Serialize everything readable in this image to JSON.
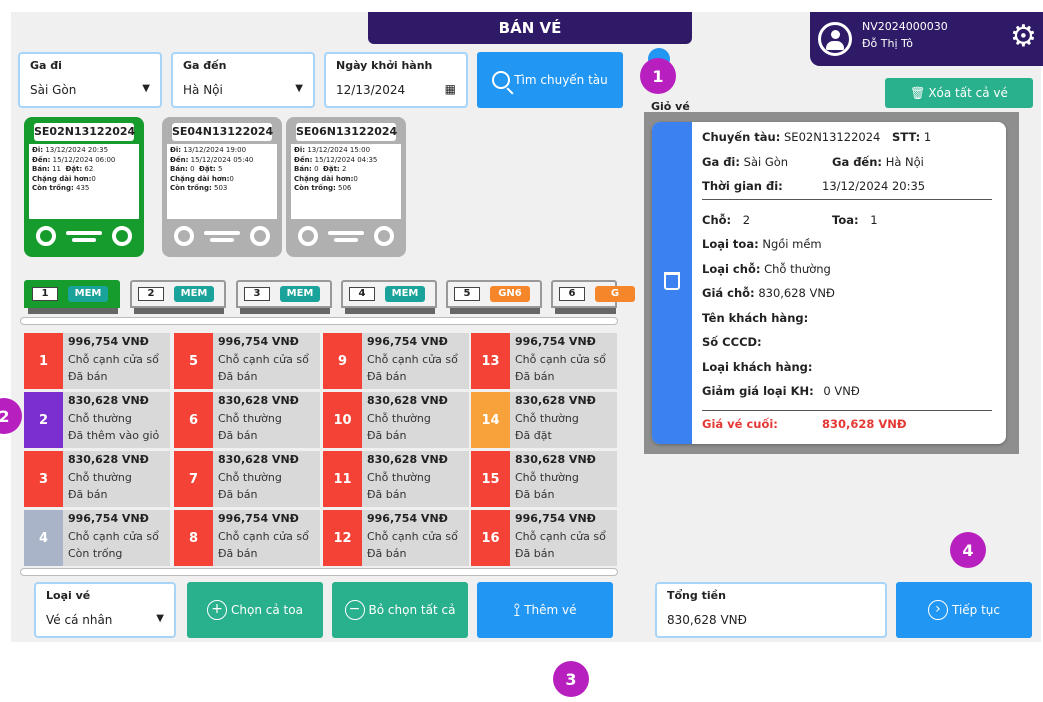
{
  "header": {
    "title": "BÁN VÉ",
    "user_id": "NV2024000030",
    "user_name": "Đỗ Thị Tô"
  },
  "search": {
    "from_label": "Ga đi",
    "from_value": "Sài Gòn",
    "to_label": "Ga đến",
    "to_value": "Hà Nội",
    "date_label": "Ngày khởi hành",
    "date_value": "12/13/2024",
    "search_button": "Tìm chuyến tàu"
  },
  "trains": [
    {
      "code": "SE02N13122024",
      "di": "13/12/2024 20:35",
      "den": "15/12/2024 06:00",
      "ban": "11",
      "dat": "62",
      "chang": "0",
      "trong": "435"
    },
    {
      "code": "SE04N13122024",
      "di": "13/12/2024 19:00",
      "den": "15/12/2024 05:40",
      "ban": "0",
      "dat": "5",
      "chang": "0",
      "trong": "503"
    },
    {
      "code": "SE06N13122024",
      "di": "13/12/2024 15:00",
      "den": "15/12/2024 04:35",
      "ban": "0",
      "dat": "2",
      "chang": "0",
      "trong": "506"
    }
  ],
  "train_labels": {
    "di": "Đi:",
    "den": "Đến:",
    "ban": "Bán:",
    "dat": "Đặt:",
    "chang": "Chặng dài hơn:",
    "trong": "Còn trống:"
  },
  "cars": [
    {
      "num": "1",
      "type": "MEM"
    },
    {
      "num": "2",
      "type": "MEM"
    },
    {
      "num": "3",
      "type": "MEM"
    },
    {
      "num": "4",
      "type": "MEM"
    },
    {
      "num": "5",
      "type": "GN6"
    },
    {
      "num": "6",
      "type": "G"
    }
  ],
  "seats": [
    {
      "num": "1",
      "price": "996,754 VNĐ",
      "kind": "Chỗ cạnh cửa sổ",
      "status": "Đã bán"
    },
    {
      "num": "2",
      "price": "830,628 VNĐ",
      "kind": "Chỗ thường",
      "status": "Đã thêm vào giỏ"
    },
    {
      "num": "3",
      "price": "830,628 VNĐ",
      "kind": "Chỗ thường",
      "status": "Đã bán"
    },
    {
      "num": "4",
      "price": "996,754 VNĐ",
      "kind": "Chỗ cạnh cửa sổ",
      "status": "Còn trống"
    },
    {
      "num": "5",
      "price": "996,754 VNĐ",
      "kind": "Chỗ cạnh cửa sổ",
      "status": "Đã bán"
    },
    {
      "num": "6",
      "price": "830,628 VNĐ",
      "kind": "Chỗ thường",
      "status": "Đã bán"
    },
    {
      "num": "7",
      "price": "830,628 VNĐ",
      "kind": "Chỗ thường",
      "status": "Đã bán"
    },
    {
      "num": "8",
      "price": "996,754 VNĐ",
      "kind": "Chỗ cạnh cửa sổ",
      "status": "Đã bán"
    },
    {
      "num": "9",
      "price": "996,754 VNĐ",
      "kind": "Chỗ cạnh cửa sổ",
      "status": "Đã bán"
    },
    {
      "num": "10",
      "price": "830,628 VNĐ",
      "kind": "Chỗ thường",
      "status": "Đã bán"
    },
    {
      "num": "11",
      "price": "830,628 VNĐ",
      "kind": "Chỗ thường",
      "status": "Đã bán"
    },
    {
      "num": "12",
      "price": "996,754 VNĐ",
      "kind": "Chỗ cạnh cửa sổ",
      "status": "Đã bán"
    },
    {
      "num": "13",
      "price": "996,754 VNĐ",
      "kind": "Chỗ cạnh cửa sổ",
      "status": "Đã bán"
    },
    {
      "num": "14",
      "price": "830,628 VNĐ",
      "kind": "Chỗ thường",
      "status": "Đã đặt"
    },
    {
      "num": "15",
      "price": "830,628 VNĐ",
      "kind": "Chỗ thường",
      "status": "Đã bán"
    },
    {
      "num": "16",
      "price": "996,754 VNĐ",
      "kind": "Chỗ cạnh cửa sổ",
      "status": "Đã bán"
    }
  ],
  "bottom": {
    "ticket_type_label": "Loại vé",
    "ticket_type_value": "Vé cá nhân",
    "select_all_car": "Chọn cả toa",
    "deselect_all": "Bỏ chọn tất cả",
    "add_ticket": "Thêm vé",
    "total_label": "Tổng tiền",
    "total_value": "830,628 VNĐ",
    "continue": "Tiếp tục"
  },
  "cart": {
    "label": "Giỏ vé",
    "clear_all": "Xóa tất cả vé",
    "ticket": {
      "train_label": "Chuyến tàu:",
      "train": "SE02N13122024",
      "stt_label": "STT:",
      "stt": "1",
      "from_label": "Ga đi:",
      "from": "Sài Gòn",
      "to_label": "Ga đến:",
      "to": "Hà Nội",
      "time_label": "Thời gian đi:",
      "time": "13/12/2024 20:35",
      "seat_label": "Chỗ:",
      "seat": "2",
      "car_label": "Toa:",
      "car": "1",
      "car_type_label": "Loại toa:",
      "car_type": "Ngồi mềm",
      "seat_type_label": "Loại chỗ:",
      "seat_type": "Chỗ thường",
      "price_label": "Giá chỗ:",
      "price": "830,628 VNĐ",
      "cust_name_label": "Tên khách hàng:",
      "cccd_label": "Số CCCD:",
      "cust_type_label": "Loại khách hàng:",
      "discount_label": "Giảm giá loại KH:",
      "discount": "0 VNĐ",
      "final_label": "Giá vé cuối:",
      "final": "830,628 VNĐ"
    }
  },
  "annotations": [
    "1",
    "2",
    "3",
    "4"
  ],
  "colors": {
    "sold": "#f44336",
    "cart": "#7b2fd0",
    "booked": "#f7a23a",
    "free": "#a9b4c8",
    "accent": "#2196f3",
    "green": "#29b08c",
    "header": "#2e1a66",
    "annotation": "#b81fbf"
  }
}
